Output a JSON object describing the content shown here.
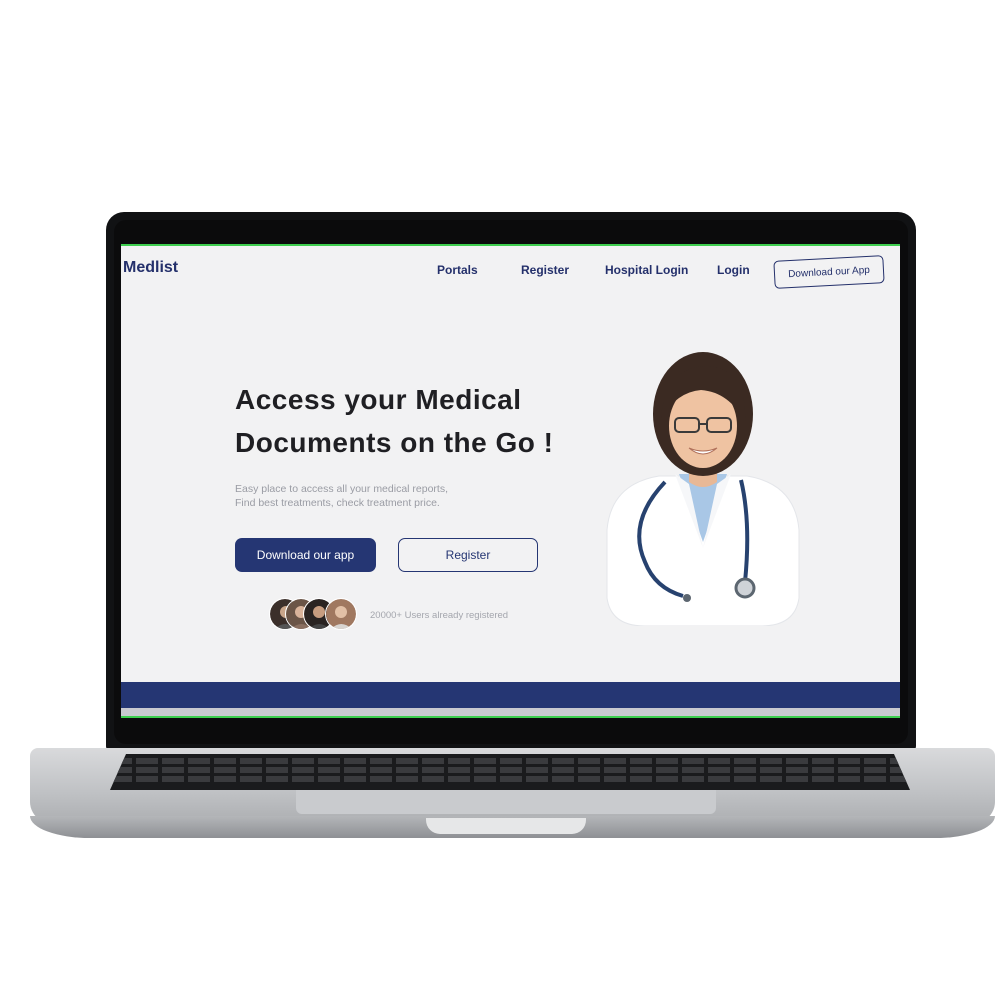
{
  "brand": "Medlist",
  "nav": {
    "portals": "Portals",
    "register": "Register",
    "hospital_login": "Hospital Login",
    "login": "Login",
    "download_app": "Download our App"
  },
  "hero": {
    "title_line1": "Access your Medical",
    "title_line2": "Documents on the Go !",
    "subtitle_line1": "Easy place to access all your medical reports,",
    "subtitle_line2": "Find best treatments, check treatment price.",
    "primary_button": "Download our app",
    "secondary_button": "Register",
    "users_text": "20000+ Users already registered"
  },
  "colors": {
    "brand": "#24306b",
    "primary": "#253673",
    "screen_background": "#f2f2f3",
    "accent_line": "#3ecf4f"
  }
}
